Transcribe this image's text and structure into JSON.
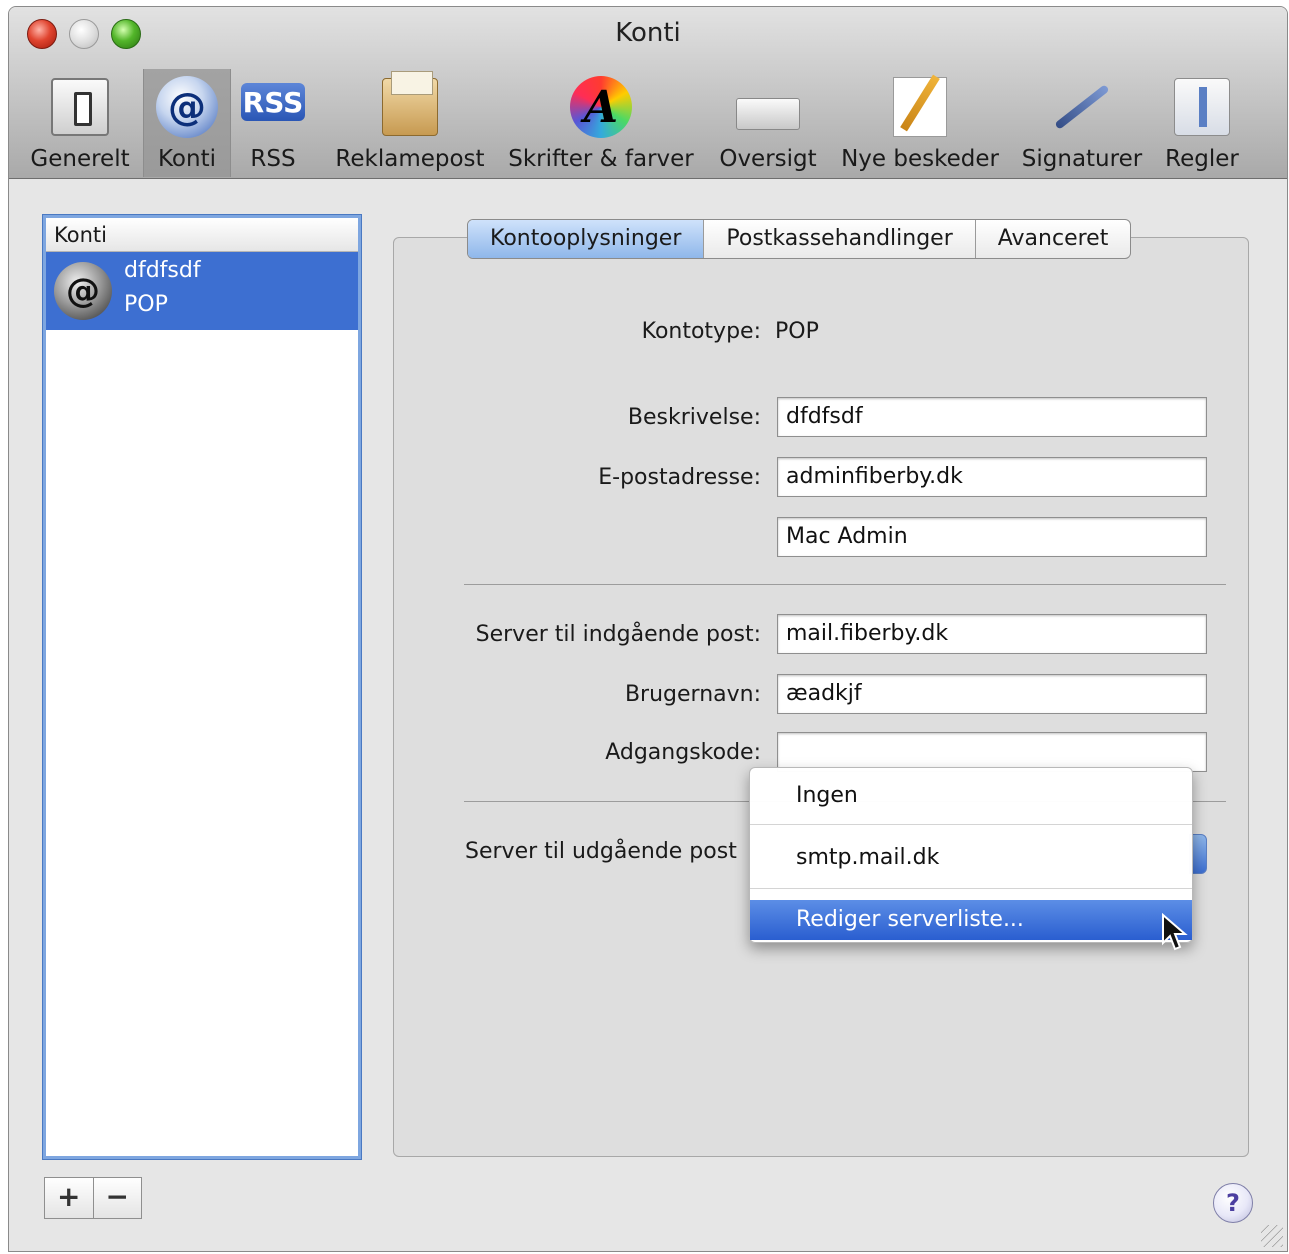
{
  "window": {
    "title": "Konti"
  },
  "toolbar": {
    "items": [
      {
        "label": "Generelt",
        "icon": "switch-icon"
      },
      {
        "label": "Konti",
        "icon": "at-icon"
      },
      {
        "label": "RSS",
        "icon": "rss-icon"
      },
      {
        "label": "Reklamepost",
        "icon": "junk-mail-icon"
      },
      {
        "label": "Skrifter & farver",
        "icon": "fonts-colors-icon"
      },
      {
        "label": "Oversigt",
        "icon": "viewing-icon"
      },
      {
        "label": "Nye beskeder",
        "icon": "compose-icon"
      },
      {
        "label": "Signaturer",
        "icon": "signature-pen-icon"
      },
      {
        "label": "Regler",
        "icon": "rules-icon"
      }
    ],
    "selected": "Konti",
    "rss_badge": "RSS",
    "font_glyph": "A",
    "at_glyph": "@"
  },
  "accounts": {
    "header": "Konti",
    "items": [
      {
        "name": "dfdfsdf",
        "type": "POP",
        "glyph": "@"
      }
    ],
    "add_label": "+",
    "remove_label": "−"
  },
  "tabs": [
    {
      "label": "Kontooplysninger",
      "active": true
    },
    {
      "label": "Postkassehandlinger",
      "active": false
    },
    {
      "label": "Avanceret",
      "active": false
    }
  ],
  "form": {
    "account_type_label": "Kontotype:",
    "account_type_value": "POP",
    "description_label": "Beskrivelse:",
    "description_value": "dfdfsdf",
    "email_label": "E-postadresse:",
    "email_value": "adminfiberby.dk",
    "full_name_value": "Mac Admin",
    "incoming_server_label": "Server til indgående post:",
    "incoming_server_value": "mail.fiberby.dk",
    "username_label": "Brugernavn:",
    "username_value": "æadkjf",
    "password_label": "Adgangskode:",
    "password_value": "",
    "outgoing_server_label": "Server til udgående post"
  },
  "outgoing_menu": {
    "options": [
      "Ingen",
      "smtp.mail.dk",
      "Rediger serverliste..."
    ],
    "highlighted": "Rediger serverliste..."
  },
  "help_label": "?",
  "colors": {
    "selection": "#3d6fd1",
    "menu_highlight": "#2a5ed0"
  }
}
